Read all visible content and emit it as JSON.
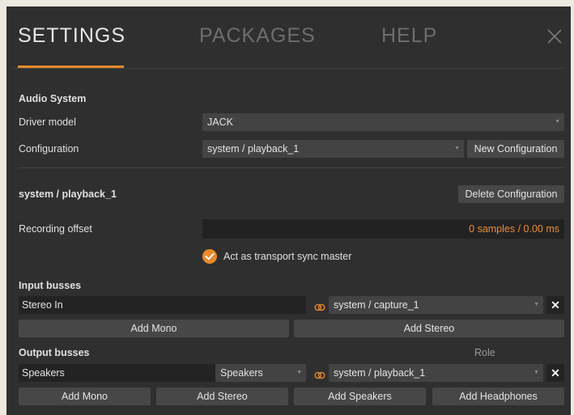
{
  "tabs": [
    {
      "label": "SETTINGS"
    },
    {
      "label": "PACKAGES"
    },
    {
      "label": "HELP"
    }
  ],
  "audio_system": {
    "heading": "Audio System",
    "driver_model_label": "Driver model",
    "driver_model_value": "JACK",
    "configuration_label": "Configuration",
    "configuration_value": "system / playback_1",
    "new_configuration_button": "New Configuration"
  },
  "config_section": {
    "title": "system / playback_1",
    "delete_button": "Delete Configuration",
    "recording_offset_label": "Recording offset",
    "recording_offset_value": "0 samples / 0.00 ms",
    "sync_master_label": "Act as transport sync master",
    "sync_master_checked": true
  },
  "input_busses": {
    "heading": "Input busses",
    "rows": [
      {
        "name": "Stereo In",
        "port": "system / capture_1"
      }
    ],
    "add_mono": "Add Mono",
    "add_stereo": "Add Stereo"
  },
  "output_busses": {
    "heading": "Output busses",
    "role_header": "Role",
    "rows": [
      {
        "name": "Speakers",
        "role": "Speakers",
        "port": "system / playback_1"
      }
    ],
    "add_mono": "Add Mono",
    "add_stereo": "Add Stereo",
    "add_speakers": "Add Speakers",
    "add_headphones": "Add Headphones"
  },
  "colors": {
    "accent": "#e8892c",
    "panel_bg": "#2f2f2f",
    "page_bg": "#ece9df"
  },
  "icons": [
    "close-icon",
    "dropdown-caret-icon",
    "checkmark-icon",
    "link-icon",
    "remove-icon"
  ]
}
